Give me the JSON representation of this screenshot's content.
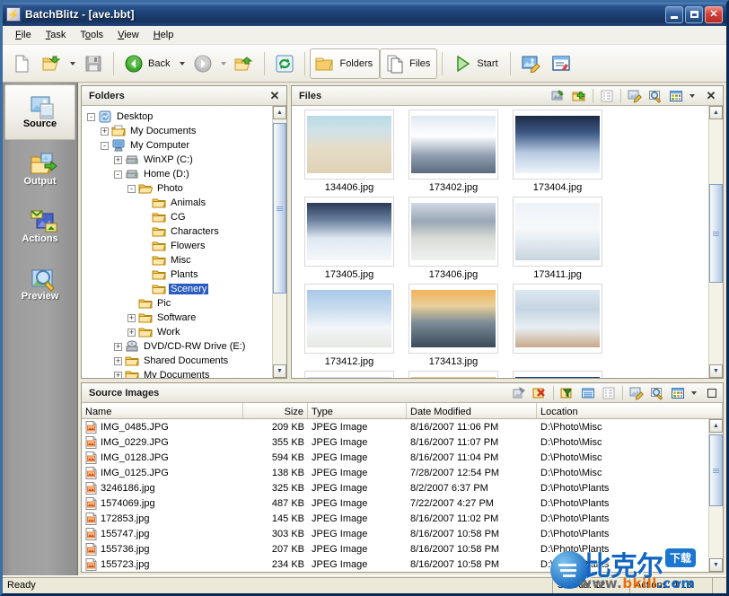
{
  "window": {
    "app_name": "BatchBlitz",
    "document": "- [ave.bbt]",
    "icon": "lightning-icon",
    "minimize_label": "Minimize",
    "maximize_label": "Maximize",
    "close_label": "Close"
  },
  "menu": [
    {
      "label": "File"
    },
    {
      "label": "Task"
    },
    {
      "label": "Tools"
    },
    {
      "label": "View"
    },
    {
      "label": "Help"
    }
  ],
  "toolbar": {
    "new_label": "New",
    "open_label": "Open",
    "save_label": "Save",
    "back_label": "Back",
    "forward_label": "Forward",
    "up_label": "Up",
    "refresh_label": "Refresh",
    "folders_label": "Folders",
    "files_label": "Files",
    "start_label": "Start",
    "edit_image_label": "Edit Image",
    "edit_list_label": "Edit List"
  },
  "rail": {
    "items": [
      {
        "label": "Source",
        "icon": "source-images-icon",
        "active": true
      },
      {
        "label": "Output",
        "icon": "output-folder-icon",
        "active": false
      },
      {
        "label": "Actions",
        "icon": "actions-icon",
        "active": false
      },
      {
        "label": "Preview",
        "icon": "preview-magnifier-icon",
        "active": false
      }
    ]
  },
  "folders_panel": {
    "title": "Folders",
    "close_label": "Close",
    "tree": [
      {
        "label": "Desktop",
        "depth": 0,
        "toggle": "-",
        "icon": "desktop-icon",
        "selected": false
      },
      {
        "label": "My Documents",
        "depth": 1,
        "toggle": "+",
        "icon": "documents-folder-icon",
        "selected": false
      },
      {
        "label": "My Computer",
        "depth": 1,
        "toggle": "-",
        "icon": "computer-icon",
        "selected": false
      },
      {
        "label": "WinXP (C:)",
        "depth": 2,
        "toggle": "+",
        "icon": "drive-icon",
        "selected": false
      },
      {
        "label": "Home (D:)",
        "depth": 2,
        "toggle": "-",
        "icon": "drive-icon",
        "selected": false
      },
      {
        "label": "Photo",
        "depth": 3,
        "toggle": "-",
        "icon": "folder-open-icon",
        "selected": false
      },
      {
        "label": "Animals",
        "depth": 4,
        "toggle": "",
        "icon": "folder-icon",
        "selected": false
      },
      {
        "label": "CG",
        "depth": 4,
        "toggle": "",
        "icon": "folder-icon",
        "selected": false
      },
      {
        "label": "Characters",
        "depth": 4,
        "toggle": "",
        "icon": "folder-icon",
        "selected": false
      },
      {
        "label": "Flowers",
        "depth": 4,
        "toggle": "",
        "icon": "folder-icon",
        "selected": false
      },
      {
        "label": "Misc",
        "depth": 4,
        "toggle": "",
        "icon": "folder-icon",
        "selected": false
      },
      {
        "label": "Plants",
        "depth": 4,
        "toggle": "",
        "icon": "folder-icon",
        "selected": false
      },
      {
        "label": "Scenery",
        "depth": 4,
        "toggle": "",
        "icon": "folder-icon",
        "selected": true
      },
      {
        "label": "Pic",
        "depth": 3,
        "toggle": "",
        "icon": "folder-icon",
        "selected": false
      },
      {
        "label": "Software",
        "depth": 3,
        "toggle": "+",
        "icon": "folder-icon",
        "selected": false
      },
      {
        "label": "Work",
        "depth": 3,
        "toggle": "+",
        "icon": "folder-icon",
        "selected": false
      },
      {
        "label": "DVD/CD-RW Drive (E:)",
        "depth": 2,
        "toggle": "+",
        "icon": "cd-drive-icon",
        "selected": false
      },
      {
        "label": "Shared Documents",
        "depth": 2,
        "toggle": "+",
        "icon": "folder-icon",
        "selected": false
      },
      {
        "label": "My Documents",
        "depth": 2,
        "toggle": "+",
        "icon": "folder-icon",
        "selected": false
      }
    ]
  },
  "files_panel": {
    "title": "Files",
    "tools": [
      "select-images-icon",
      "add-images-icon",
      "list-icon",
      "edit-icon",
      "search-icon",
      "view-mode-icon"
    ],
    "close_label": "Close",
    "thumbnails": [
      {
        "name": "134406.jpg"
      },
      {
        "name": "173402.jpg"
      },
      {
        "name": "173404.jpg"
      },
      {
        "name": "173405.jpg"
      },
      {
        "name": "173406.jpg"
      },
      {
        "name": "173411.jpg"
      },
      {
        "name": "173412.jpg"
      },
      {
        "name": "173413.jpg"
      },
      {
        "name": ""
      },
      {
        "name": ""
      },
      {
        "name": ""
      },
      {
        "name": ""
      }
    ]
  },
  "source_images_panel": {
    "title": "Source Images",
    "tools": [
      "add-icon",
      "remove-icon",
      "filter-icon",
      "details-icon",
      "list-icon",
      "edit-icon",
      "search-icon",
      "view-mode-icon"
    ],
    "columns": [
      "Name",
      "Size",
      "Type",
      "Date Modified",
      "Location"
    ],
    "rows": [
      {
        "name": "IMG_0485.JPG",
        "size": "209 KB",
        "type": "JPEG Image",
        "date": "8/16/2007 11:06 PM",
        "location": "D:\\Photo\\Misc"
      },
      {
        "name": "IMG_0229.JPG",
        "size": "355 KB",
        "type": "JPEG Image",
        "date": "8/16/2007 11:07 PM",
        "location": "D:\\Photo\\Misc"
      },
      {
        "name": "IMG_0128.JPG",
        "size": "594 KB",
        "type": "JPEG Image",
        "date": "8/16/2007 11:04 PM",
        "location": "D:\\Photo\\Misc"
      },
      {
        "name": "IMG_0125.JPG",
        "size": "138 KB",
        "type": "JPEG Image",
        "date": "7/28/2007 12:54 PM",
        "location": "D:\\Photo\\Misc"
      },
      {
        "name": "3246186.jpg",
        "size": "325 KB",
        "type": "JPEG Image",
        "date": "8/2/2007 6:37 PM",
        "location": "D:\\Photo\\Plants"
      },
      {
        "name": "1574069.jpg",
        "size": "487 KB",
        "type": "JPEG Image",
        "date": "7/22/2007 4:27 PM",
        "location": "D:\\Photo\\Plants"
      },
      {
        "name": "172853.jpg",
        "size": "145 KB",
        "type": "JPEG Image",
        "date": "8/16/2007 11:02 PM",
        "location": "D:\\Photo\\Plants"
      },
      {
        "name": "155747.jpg",
        "size": "303 KB",
        "type": "JPEG Image",
        "date": "8/16/2007 10:58 PM",
        "location": "D:\\Photo\\Plants"
      },
      {
        "name": "155736.jpg",
        "size": "207 KB",
        "type": "JPEG Image",
        "date": "8/16/2007 10:58 PM",
        "location": "D:\\Photo\\Plants"
      },
      {
        "name": "155723.jpg",
        "size": "234 KB",
        "type": "JPEG Image",
        "date": "8/16/2007 10:58 PM",
        "location": "D:\\Photo\\Plants"
      }
    ]
  },
  "statusbar": {
    "message": "Ready",
    "source_count": "Source: 12",
    "actions_count": "Actions: 4/13"
  },
  "watermark": {
    "brand_cn": "比克尔",
    "badge_cn": "下载",
    "url_prefix": "www.",
    "url_name": "bkill",
    "url_suffix": ".com"
  },
  "colors": {
    "titlebar": "#1d4176",
    "accent": "#2a5cc0",
    "selection": "#2a5cc0",
    "panel_bg": "#ece9d8",
    "close_red": "#d9433a",
    "watermark_blue": "#1165c0",
    "watermark_orange": "#e8700f"
  }
}
